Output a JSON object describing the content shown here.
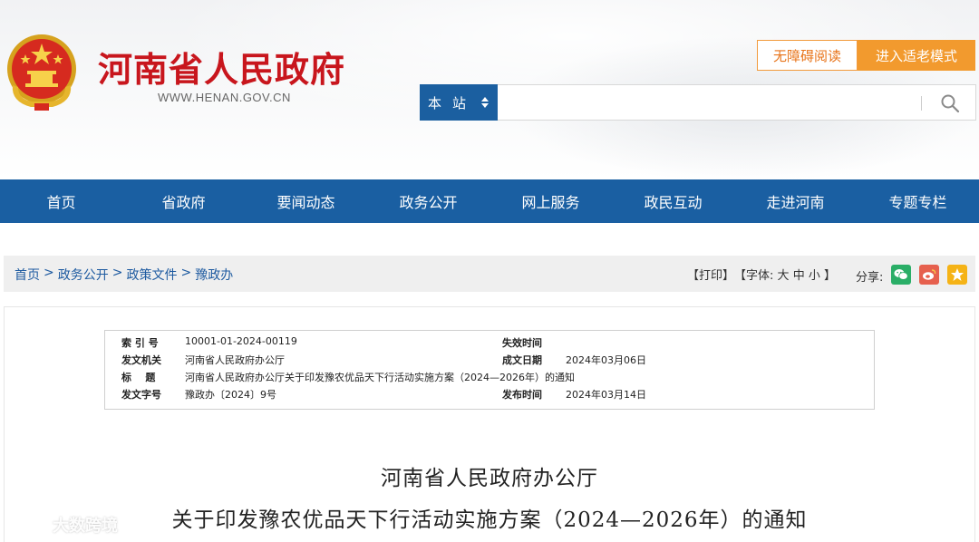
{
  "header": {
    "site_title": "河南省人民政府",
    "site_url": "WWW.HENAN.GOV.CN",
    "accessibility_button": "无障碍阅读",
    "elder_mode_button": "进入适老模式",
    "search": {
      "scope_label": "本站",
      "placeholder": ""
    }
  },
  "nav": {
    "items": [
      "首页",
      "省政府",
      "要闻动态",
      "政务公开",
      "网上服务",
      "政民互动",
      "走进河南",
      "专题专栏"
    ]
  },
  "breadcrumb": {
    "items": [
      "首页",
      "政务公开",
      "政策文件",
      "豫政办"
    ],
    "separator": ">"
  },
  "tools": {
    "print": "【打印】",
    "font_label": "【字体:",
    "font_large": "大",
    "font_medium": "中",
    "font_small": "小",
    "font_close": "】",
    "share_label": "分享:"
  },
  "meta": {
    "index_label": "索 引 号",
    "index_value": "10001-01-2024-00119",
    "expire_label": "失效时间",
    "expire_value": "",
    "issuer_label": "发文机关",
    "issuer_value": "河南省人民政府办公厅",
    "date_label": "成文日期",
    "date_value": "2024年03月06日",
    "title_label": "标    题",
    "title_value": "河南省人民政府办公厅关于印发豫农优品天下行活动实施方案（2024—2026年）的通知",
    "docno_label": "发文字号",
    "docno_value": "豫政办〔2024〕9号",
    "publish_label": "发布时间",
    "publish_value": "2024年03月14日"
  },
  "document": {
    "title_line1": "河南省人民政府办公厅",
    "title_line2": "关于印发豫农优品天下行活动实施方案（2024—2026年）的通知"
  },
  "watermark": {
    "text": "大数跨境"
  },
  "colors": {
    "brand_red": "#c8161d",
    "nav_blue": "#1a5fa2",
    "elder_orange": "#f29a2e",
    "wechat_green": "#2aae67",
    "weibo_red": "#e6604e",
    "qzone_yellow": "#f5b316"
  }
}
